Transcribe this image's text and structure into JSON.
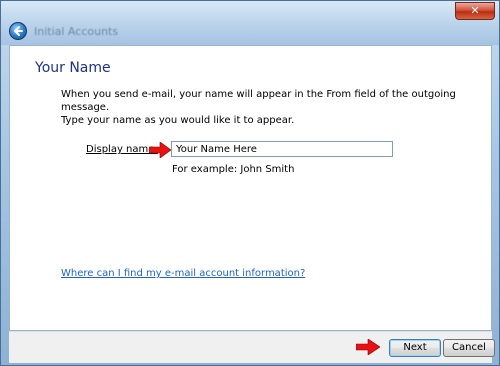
{
  "window": {
    "title": "Initial Accounts",
    "close_glyph": "✕"
  },
  "page": {
    "heading": "Your Name",
    "description_line1": "When you send e-mail, your name will appear in the From field of the outgoing message.",
    "description_line2": "Type your name as you would like it to appear."
  },
  "form": {
    "display_name_label": "Display name:",
    "display_name_value": "Your Name Here",
    "example_text": "For example: John Smith"
  },
  "help": {
    "link_text": "Where can I find my e-mail account information?"
  },
  "footer": {
    "next_label": "Next",
    "cancel_label": "Cancel"
  },
  "colors": {
    "arrow": "#e81212",
    "heading": "#1e3287",
    "link": "#1f63c6"
  }
}
